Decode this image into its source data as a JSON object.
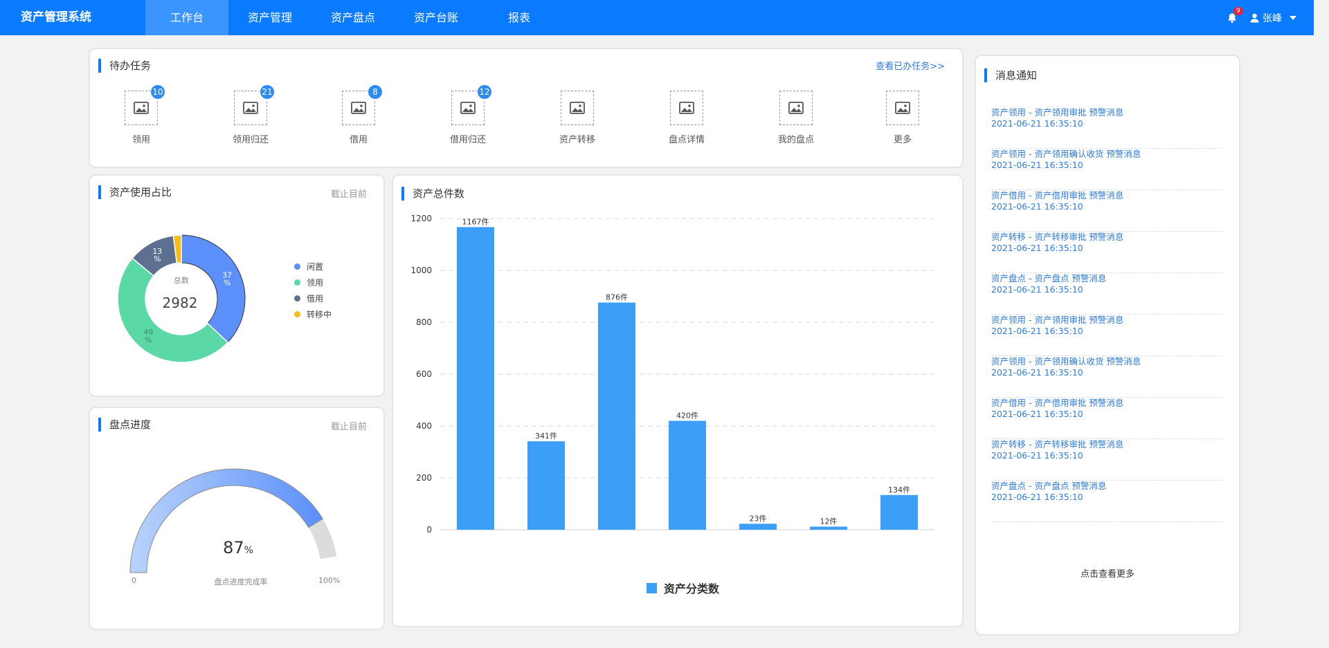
{
  "app": {
    "title": "资产管理系统"
  },
  "nav": {
    "items": [
      {
        "label": "工作台",
        "active": true
      },
      {
        "label": "资产管理",
        "active": false
      },
      {
        "label": "资产盘点",
        "active": false
      },
      {
        "label": "资产台账",
        "active": false
      },
      {
        "label": "报表",
        "active": false
      }
    ]
  },
  "user": {
    "name": "张峰",
    "notification_count": "9"
  },
  "todo": {
    "title": "待办任务",
    "link": "查看已办任务>>",
    "items": [
      {
        "label": "领用",
        "badge": "10"
      },
      {
        "label": "领用归还",
        "badge": "21"
      },
      {
        "label": "借用",
        "badge": "8"
      },
      {
        "label": "借用归还",
        "badge": "12"
      },
      {
        "label": "资产转移",
        "badge": ""
      },
      {
        "label": "盘点详情",
        "badge": ""
      },
      {
        "label": "我的盘点",
        "badge": ""
      },
      {
        "label": "更多",
        "badge": ""
      }
    ]
  },
  "usage": {
    "title": "资产使用占比",
    "link": "截止目前",
    "center_label": "总数",
    "center_value": "2982",
    "slices": [
      {
        "name": "闲置",
        "percent": 37,
        "label": "37%",
        "color": "#5b8ff9"
      },
      {
        "name": "领用",
        "percent": 49,
        "label": "49%",
        "color": "#5ad8a6"
      },
      {
        "name": "借用",
        "percent": 12,
        "label": "13%",
        "color": "#5d7092"
      },
      {
        "name": "转移中",
        "percent": 2,
        "label": "",
        "color": "#f6bd16"
      }
    ]
  },
  "progress": {
    "title": "盘点进度",
    "link": "截止目前",
    "value": 87,
    "value_text": "87",
    "unit": "%",
    "min_label": "0",
    "max_label": "100%",
    "caption": "盘点进度完成率"
  },
  "chart_data": {
    "type": "bar",
    "title": "资产总件数",
    "categories": [
      "",
      "",
      "",
      "",
      "",
      "",
      ""
    ],
    "series": [
      {
        "name": "资产分类数",
        "values": [
          1167,
          341,
          876,
          420,
          23,
          12,
          134
        ]
      }
    ],
    "data_labels": [
      "1167件",
      "341件",
      "876件",
      "420件",
      "23件",
      "12件",
      "134件"
    ],
    "ylim": [
      0,
      1200
    ],
    "yticks": [
      "0",
      "200",
      "400",
      "600",
      "800",
      "1000",
      "1200"
    ],
    "grid": true,
    "legend": "bottom",
    "bar_color": "#3b9ff8"
  },
  "messages": {
    "title": "消息通知",
    "items": [
      {
        "title": "资产领用 - 资产领用审批 预警消息",
        "time": "2021-06-21 16:35:10"
      },
      {
        "title": "资产领用 - 资产领用确认收货 预警消息",
        "time": "2021-06-21 16:35:10"
      },
      {
        "title": "资产借用 - 资产借用审批 预警消息",
        "time": "2021-06-21 16:35:10"
      },
      {
        "title": "资产转移 - 资产转移审批 预警消息",
        "time": "2021-06-21 16:35:10"
      },
      {
        "title": "资产盘点 - 资产盘点 预警消息",
        "time": "2021-06-21 16:35:10"
      },
      {
        "title": "资产领用 - 资产领用审批 预警消息",
        "time": "2021-06-21 16:35:10"
      },
      {
        "title": "资产领用 - 资产领用确认收货 预警消息",
        "time": "2021-06-21 16:35:10"
      },
      {
        "title": "资产借用 - 资产借用审批 预警消息",
        "time": "2021-06-21 16:35:10"
      },
      {
        "title": "资产转移 - 资产转移审批 预警消息",
        "time": "2021-06-21 16:35:10"
      },
      {
        "title": "资产盘点 - 资产盘点 预警消息",
        "time": "2021-06-21 16:35:10"
      }
    ],
    "more": "点击查看更多"
  }
}
